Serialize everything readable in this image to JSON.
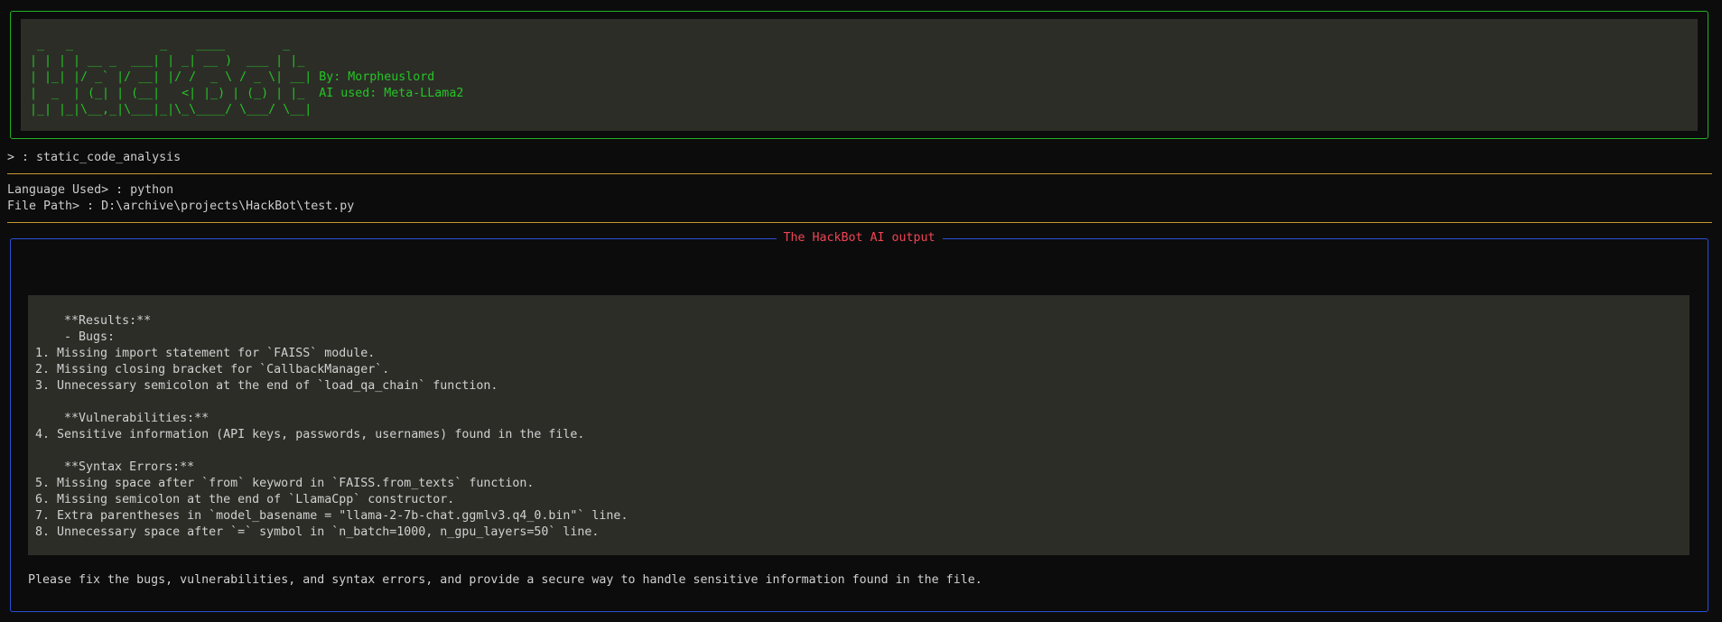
{
  "banner": {
    "ascii_lines": [
      " _   _            _    ____        _   ",
      "| | | | __ _  ___| | _| __ )  ___ | |_ ",
      "| |_| |/ _` |/ __| |/ /  _ \\ / _ \\| __| By: Morpheuslord",
      "|  _  | (_| | (__|   <| |_) | (_) | |_  AI used: Meta-LLama2",
      "|_| |_|\\__,_|\\___|_|\\_\\____/ \\___/ \\__|"
    ]
  },
  "prompt": {
    "command": "> : static_code_analysis"
  },
  "config": {
    "language": "Language Used> : python",
    "file_path": "File Path> : D:\\archive\\projects\\HackBot\\test.py"
  },
  "output": {
    "title": "The HackBot AI output",
    "code_lines": [
      "    **Results:**",
      "    - Bugs:",
      "1. Missing import statement for `FAISS` module.",
      "2. Missing closing bracket for `CallbackManager`.",
      "3. Unnecessary semicolon at the end of `load_qa_chain` function.",
      "",
      "    **Vulnerabilities:**",
      "4. Sensitive information (API keys, passwords, usernames) found in the file.",
      "",
      "    **Syntax Errors:**",
      "5. Missing space after `from` keyword in `FAISS.from_texts` function.",
      "6. Missing semicolon at the end of `LlamaCpp` constructor.",
      "7. Extra parentheses in `model_basename = \"llama-2-7b-chat.ggmlv3.q4_0.bin\"` line.",
      "8. Unnecessary space after `=` symbol in `n_batch=1000, n_gpu_layers=50` line."
    ],
    "footer": "Please fix the bugs, vulnerabilities, and syntax errors, and provide a secure way to handle sensitive information found in the file."
  },
  "colors": {
    "banner_border": "#24b024",
    "banner_text": "#23c523",
    "rule": "#c9962d",
    "output_border": "#2a50d8",
    "output_title": "#ee4455",
    "background": "#0c0c0c",
    "panel": "#2d2d28"
  }
}
